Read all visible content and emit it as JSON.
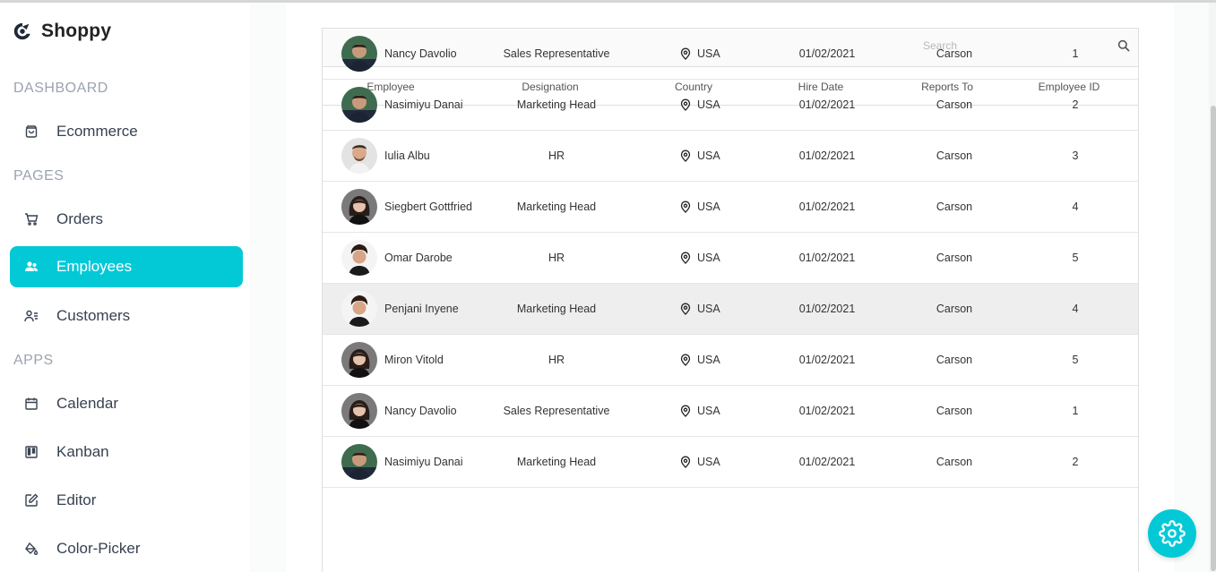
{
  "app": {
    "name": "Shoppy"
  },
  "sidebar": {
    "sections": [
      {
        "title": "DASHBOARD",
        "items": [
          {
            "label": "Ecommerce",
            "icon": "shopping-bag-icon"
          }
        ]
      },
      {
        "title": "PAGES",
        "items": [
          {
            "label": "Orders",
            "icon": "cart-icon"
          },
          {
            "label": "Employees",
            "icon": "employees-icon",
            "active": true
          },
          {
            "label": "Customers",
            "icon": "customers-icon"
          }
        ]
      },
      {
        "title": "APPS",
        "items": [
          {
            "label": "Calendar",
            "icon": "calendar-icon"
          },
          {
            "label": "Kanban",
            "icon": "kanban-icon"
          },
          {
            "label": "Editor",
            "icon": "editor-icon"
          },
          {
            "label": "Color-Picker",
            "icon": "color-picker-icon"
          }
        ]
      }
    ],
    "active_color": "#03c9d7"
  },
  "grid": {
    "search": {
      "placeholder": "Search",
      "value": ""
    },
    "columns": [
      "Employee",
      "Designation",
      "Country",
      "Hire Date",
      "Reports To",
      "Employee ID"
    ],
    "rows": [
      {
        "name": "Nancy Davolio",
        "designation": "Sales Representative",
        "country": "USA",
        "hire_date": "01/02/2021",
        "reports_to": "Carson",
        "id": "1",
        "avatar": "man-green"
      },
      {
        "name": "Nasimiyu Danai",
        "designation": "Marketing Head",
        "country": "USA",
        "hire_date": "01/02/2021",
        "reports_to": "Carson",
        "id": "2",
        "avatar": "man-green"
      },
      {
        "name": "Iulia Albu",
        "designation": "HR",
        "country": "USA",
        "hire_date": "01/02/2021",
        "reports_to": "Carson",
        "id": "3",
        "avatar": "man-light"
      },
      {
        "name": "Siegbert Gottfried",
        "designation": "Marketing Head",
        "country": "USA",
        "hire_date": "01/02/2021",
        "reports_to": "Carson",
        "id": "4",
        "avatar": "woman"
      },
      {
        "name": "Omar Darobe",
        "designation": "HR",
        "country": "USA",
        "hire_date": "01/02/2021",
        "reports_to": "Carson",
        "id": "5",
        "avatar": "man-curly"
      },
      {
        "name": "Penjani Inyene",
        "designation": "Marketing Head",
        "country": "USA",
        "hire_date": "01/02/2021",
        "reports_to": "Carson",
        "id": "4",
        "avatar": "man-curly",
        "highlight": true
      },
      {
        "name": "Miron Vitold",
        "designation": "HR",
        "country": "USA",
        "hire_date": "01/02/2021",
        "reports_to": "Carson",
        "id": "5",
        "avatar": "woman"
      },
      {
        "name": "Nancy Davolio",
        "designation": "Sales Representative",
        "country": "USA",
        "hire_date": "01/02/2021",
        "reports_to": "Carson",
        "id": "1",
        "avatar": "woman"
      },
      {
        "name": "Nasimiyu Danai",
        "designation": "Marketing Head",
        "country": "USA",
        "hire_date": "01/02/2021",
        "reports_to": "Carson",
        "id": "2",
        "avatar": "man-green"
      }
    ]
  },
  "settings_button": {
    "icon": "gear-icon",
    "color": "#03c9d7"
  }
}
